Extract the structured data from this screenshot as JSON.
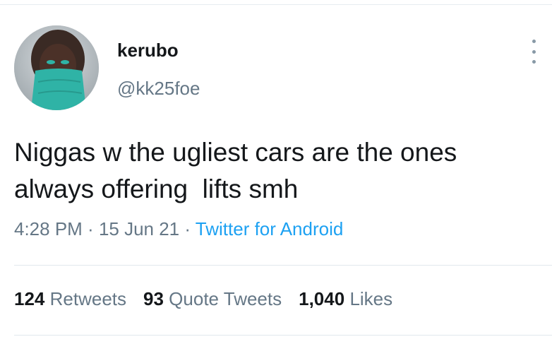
{
  "user": {
    "display_name": "kerubo",
    "handle": "@kk25foe"
  },
  "tweet": {
    "text": "Niggas w the ugliest cars are the ones\nalways offering  lifts smh",
    "time": "4:28 PM",
    "date": "15 Jun 21",
    "separator": " · ",
    "source": "Twitter for Android"
  },
  "stats": {
    "retweets_count": "124",
    "retweets_label": "Retweets",
    "quotes_count": "93",
    "quotes_label": "Quote Tweets",
    "likes_count": "1,040",
    "likes_label": "Likes"
  },
  "icons": {
    "more": "more-vertical-icon"
  },
  "colors": {
    "link": "#1da1f2",
    "secondary_text": "#657786",
    "primary_text": "#14171a",
    "avatar_mask": "#2fb3a6"
  }
}
